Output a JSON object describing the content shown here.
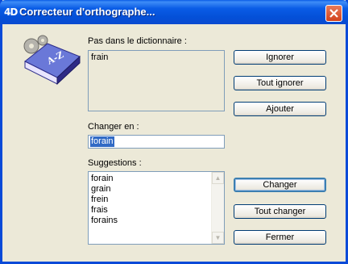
{
  "window": {
    "logo": "4D",
    "title": "Correcteur d'orthographe...",
    "close_icon": "close-icon"
  },
  "not_in_dict": {
    "label": "Pas dans le dictionnaire :",
    "value": "frain"
  },
  "change_to": {
    "label": "Changer en :",
    "value": "forain"
  },
  "suggestions": {
    "label": "Suggestions :",
    "items": [
      "forain",
      "grain",
      "frein",
      "frais",
      "forains"
    ]
  },
  "buttons": {
    "ignore": "Ignorer",
    "ignore_all": "Tout ignorer",
    "add": "Ajouter",
    "change": "Changer",
    "change_all": "Tout changer",
    "close": "Fermer"
  },
  "colors": {
    "title_bar": "#0a5ce6",
    "close_button": "#d2421c",
    "selection": "#316ac5"
  }
}
